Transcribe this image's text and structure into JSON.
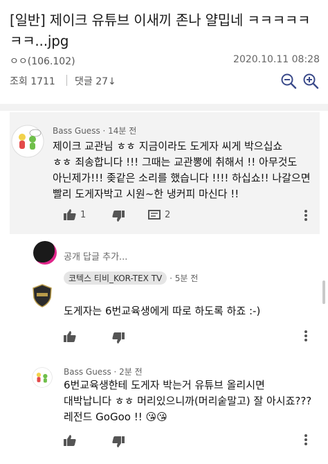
{
  "post": {
    "title": "[일반] 제이크 유튜브 이새끼 존나 얄밉네 ㅋㅋㅋㅋㅋㅋㅋ...jpg",
    "author": "ㅇㅇ(106.102)",
    "datetime": "2020.10.11 08:28",
    "views": "조회 1711",
    "comments": "댓글 27↓",
    "icons": {
      "zoom_out": "zoom-out-icon",
      "zoom_in": "zoom-in-icon"
    }
  },
  "comment1": {
    "author": "Bass Guess",
    "time": "14분 전",
    "text_lines": [
      "제이크 교관님 ㅎㅎ 지금이라도 도게자 씨게 박으십쇼",
      "ㅎㅎ 죄송합니다 !!! 그때는 교관뽕에 취해서 !! 아무것도",
      "아닌제가!!! 좆같은 소리를 했습니다 !!!! 하십쇼!! 나갈으면",
      "빨리 도게자박고 시원~한 냉커피 마신다 !!"
    ],
    "likes": "1",
    "replies": "2"
  },
  "reply_box": {
    "placeholder": "공개 답글 추가..."
  },
  "comment2": {
    "author": "코텍스 티비_KOR-TEX TV",
    "time": "5분 전",
    "text": "도게자는 6번교육생에게 따로 하도록 하죠 :-)"
  },
  "comment3": {
    "author": "Bass Guess",
    "time": "2분 전",
    "text_lines": [
      "6번교육생한테 도게자 박는거 유튜브 올리시면",
      "대박납니다 ㅎㅎ 머리있으니까(머리숱말고) 잘 아시죠???",
      "레전드 GoGoo !! 😘😘"
    ]
  },
  "colors": {
    "highlight_bg": "#f3f3f3",
    "text": "#111111",
    "meta": "#606060"
  }
}
